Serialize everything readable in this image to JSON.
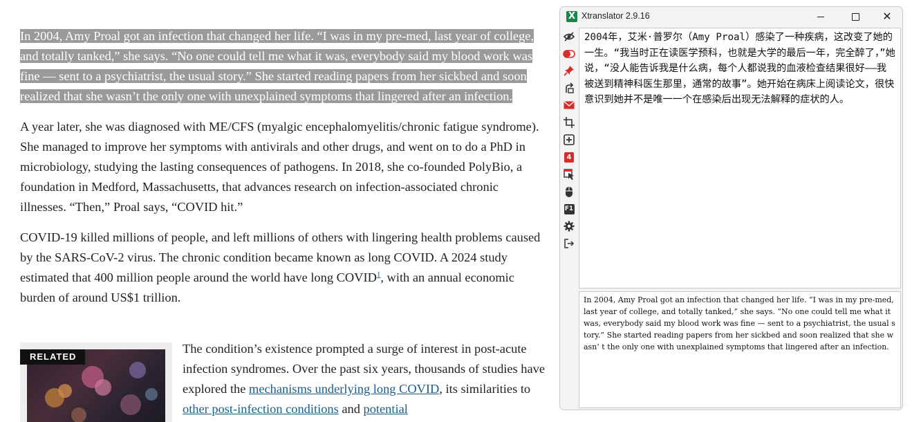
{
  "article": {
    "p1": "In 2004, Amy Proal got an infection that changed her life. “I was in my pre-med, last year of college, and totally tanked,” she says. “No one could tell me what it was, everybody said my blood work was fine — sent to a psychiatrist, the usual story.” She started reading papers from her sickbed and soon realized that she wasn’t the only one with unexplained symptoms that lingered after an infection.",
    "p2": "A year later, she was diagnosed with ME/CFS (myalgic encephalomyelitis/chronic fatigue syndrome). She managed to improve her symptoms with antivirals and other drugs, and went on to do a PhD in microbiology, studying the lasting consequences of pathogens. In 2018, she co-founded PolyBio, a foundation in Medford, Massachusetts, that advances research on infection-associated chronic illnesses. “Then,” Proal says, “COVID hit.”",
    "p3_before": "COVID-19 killed millions of people, and left millions of others with lingering health problems caused by the SARS-CoV-2 virus. The chronic condition became known as long COVID. A 2024 study estimated that 400 million people around the world have long COVID",
    "p3_sup": "1",
    "p3_after": ", with an annual economic burden of around US$1 trillion.",
    "related_label": "RELATED",
    "p4_before": "The condition’s existence prompted a surge of interest in post-acute infection syndromes. Over the past six years, thousands of studies have explored the ",
    "p4_link1": "mechanisms underlying long COVID",
    "p4_mid": ", its similarities to ",
    "p4_link2": "other post-infection conditions",
    "p4_and": " and ",
    "p4_link3": "potential"
  },
  "translator": {
    "title": "Xtranslator 2.9.16",
    "app_icon_letter": "X",
    "translated_text": "2004年，艾米·普罗尔（Amy Proal）感染了一种疾病，这改变了她的一生。“我当时正在读医学预科，也就是大学的最后一年，完全醉了，”她说，“没人能告诉我是什么病，每个人都说我的血液检查结果很好——我被送到精神科医生那里，通常的故事”。她开始在病床上阅读论文，很快意识到她并不是唯一一个在感染后出现无法解释的症状的人。",
    "source_text": "In 2004, Amy Proal got an infection that changed her life. “I was in my pre-med, last year of college, and totally tanked,” she says. “No one could tell me what it was, everybody said my blood work was fine — sent to a psychiatrist, the usual story.” She started reading papers from her sickbed and soon realized that she wasn’ t the only one with unexplained symptoms that lingered after an infection.",
    "badge_number": "4",
    "f1_label": "F1",
    "tools": [
      "eye-off-icon",
      "toggle-icon",
      "pin-icon",
      "rotate-icon",
      "mail-icon",
      "crop-icon",
      "plus-box-icon",
      "badge-icon",
      "pointer-select-icon",
      "mouse-icon",
      "f1-key-icon",
      "gear-icon",
      "exit-icon"
    ]
  },
  "colors": {
    "highlight_bg": "#9a9a9a",
    "link": "#1a5d8b",
    "red_icon": "#d92b2b",
    "app_green": "#14894a"
  }
}
